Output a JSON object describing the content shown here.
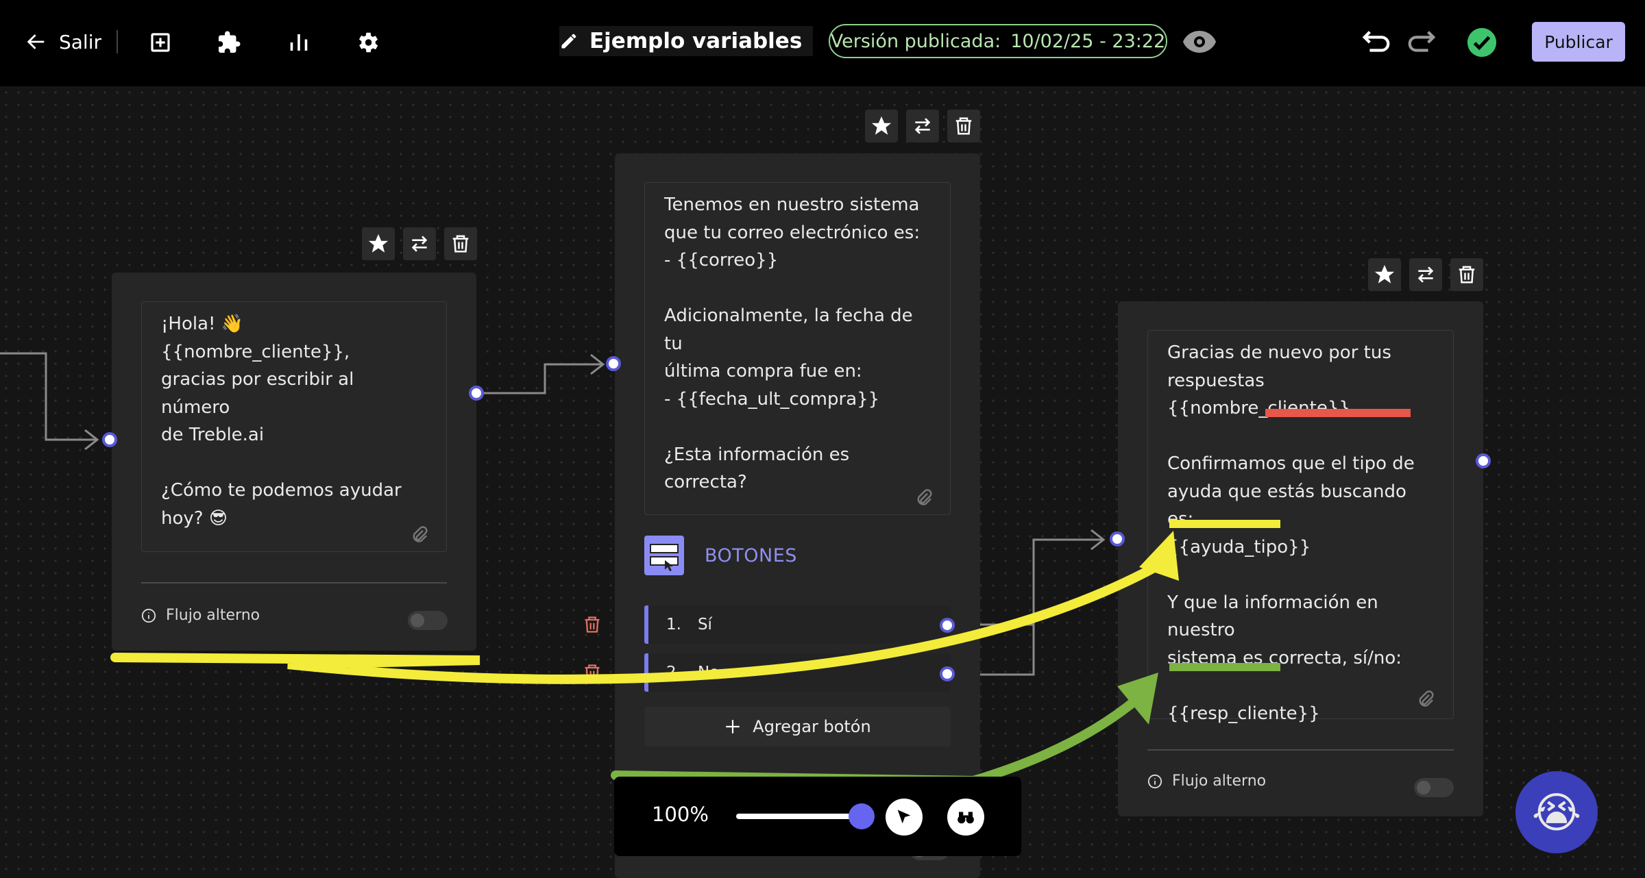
{
  "topbar": {
    "exit_label": "Salir",
    "flow_name": "Ejemplo variables",
    "version_label": "Versión publicada:",
    "version_date": "10/02/25 - 23:22",
    "publish_label": "Publicar"
  },
  "nodes": {
    "left": {
      "message": "¡Hola! 👋 {{nombre_cliente}},\ngracias por escribir al número\nde Treble.ai\n\n¿Cómo te podemos ayudar\nhoy? 😎",
      "alt_flow_label": "Flujo alterno"
    },
    "center": {
      "message": "Tenemos en nuestro sistema\nque tu correo electrónico es:\n- {{correo}}\n\nAdicionalmente, la fecha de tu\núltima compra fue en:\n- {{fecha_ult_compra}}\n\n¿Esta información es correcta?",
      "buttons_title": "BOTONES",
      "buttons": [
        {
          "num": "1.",
          "label": "Sí"
        },
        {
          "num": "2.",
          "label": "No"
        }
      ],
      "add_button_label": "Agregar botón"
    },
    "right": {
      "message": "Gracias de nuevo por tus\nrespuestas {{nombre_cliente}}\n\nConfirmamos que el tipo de\nayuda que estás buscando es:\n{{ayuda_tipo}}\n\nY que la información en nuestro\nsistema es correcta, sí/no:\n\n{{resp_cliente}}",
      "alt_flow_label": "Flujo alterno"
    }
  },
  "zoom": {
    "label": "100%",
    "level": 1.0
  },
  "colors": {
    "accent": "#6c6cf0",
    "publish_bg": "#b9b4f7",
    "success": "#3ec46d",
    "highlight_yellow": "#f3ec3a",
    "highlight_green": "#7cb342",
    "highlight_red": "#e8574a"
  },
  "icons": {
    "exit": "arrow-left-icon",
    "add": "plus-square-icon",
    "integrations": "puzzle-icon",
    "analytics": "bar-chart-icon",
    "settings": "gear-icon",
    "edit": "pencil-icon",
    "preview": "eye-icon",
    "undo": "undo-icon",
    "redo": "redo-icon",
    "status": "check-circle-icon"
  }
}
